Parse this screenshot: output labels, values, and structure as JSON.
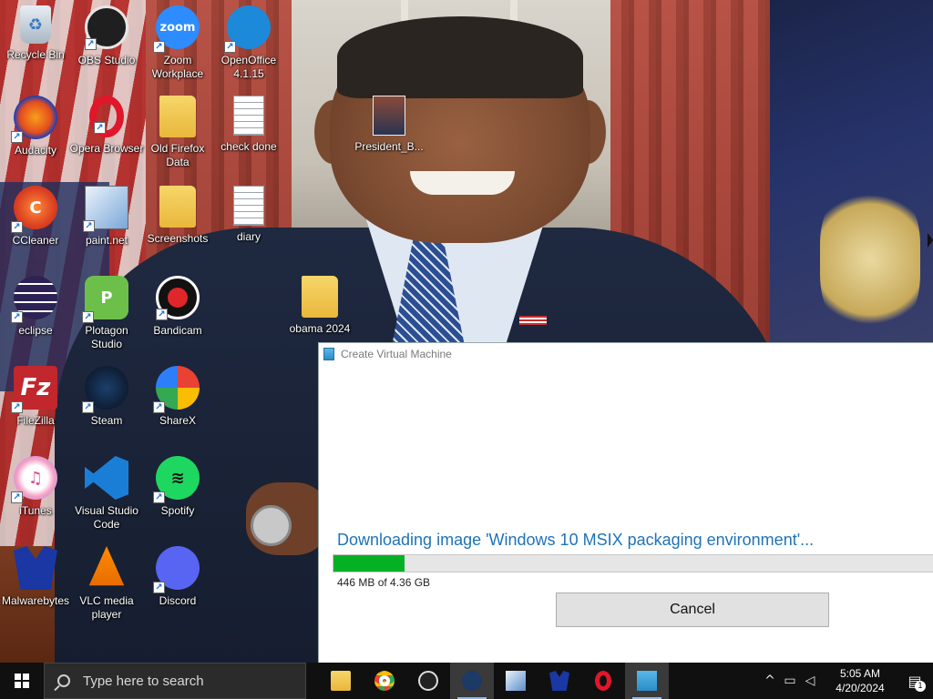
{
  "desktop": {
    "icons": [
      {
        "name": "recycle-bin",
        "label": "Recycle Bin",
        "glyph": "♻",
        "shortcut": false
      },
      {
        "name": "obs-studio",
        "label": "OBS Studio",
        "glyph": "",
        "shortcut": true
      },
      {
        "name": "zoom-workplace",
        "label": "Zoom Workplace",
        "glyph": "zoom",
        "shortcut": true
      },
      {
        "name": "openoffice",
        "label": "OpenOffice 4.1.15",
        "glyph": "",
        "shortcut": true
      },
      {
        "name": "audacity",
        "label": "Audacity",
        "glyph": "",
        "shortcut": true
      },
      {
        "name": "opera-browser",
        "label": "Opera Browser",
        "glyph": "",
        "shortcut": true
      },
      {
        "name": "old-firefox-data",
        "label": "Old Firefox Data",
        "glyph": "",
        "shortcut": false
      },
      {
        "name": "check-done",
        "label": "check done",
        "glyph": "",
        "shortcut": false
      },
      {
        "name": "president",
        "label": "President_B...",
        "glyph": "",
        "shortcut": false
      },
      {
        "name": "ccleaner",
        "label": "CCleaner",
        "glyph": "C",
        "shortcut": true
      },
      {
        "name": "paint-net",
        "label": "paint.net",
        "glyph": "",
        "shortcut": true
      },
      {
        "name": "screenshots",
        "label": "Screenshots",
        "glyph": "",
        "shortcut": false
      },
      {
        "name": "diary",
        "label": "diary",
        "glyph": "",
        "shortcut": false
      },
      {
        "name": "eclipse",
        "label": "eclipse",
        "glyph": "",
        "shortcut": true
      },
      {
        "name": "plotagon-studio",
        "label": "Plotagon Studio",
        "glyph": "P",
        "shortcut": true
      },
      {
        "name": "bandicam",
        "label": "Bandicam",
        "glyph": "",
        "shortcut": true
      },
      {
        "name": "obama-2024",
        "label": "obama 2024",
        "glyph": "",
        "shortcut": false
      },
      {
        "name": "filezilla",
        "label": "FileZilla",
        "glyph": "Fz",
        "shortcut": true
      },
      {
        "name": "steam",
        "label": "Steam",
        "glyph": "",
        "shortcut": true
      },
      {
        "name": "sharex",
        "label": "ShareX",
        "glyph": "",
        "shortcut": true
      },
      {
        "name": "itunes",
        "label": "iTunes",
        "glyph": "♫",
        "shortcut": true
      },
      {
        "name": "visual-studio-code",
        "label": "Visual Studio Code",
        "glyph": "",
        "shortcut": true
      },
      {
        "name": "spotify",
        "label": "Spotify",
        "glyph": "≋",
        "shortcut": true
      },
      {
        "name": "malwarebytes",
        "label": "Malwarebytes",
        "glyph": "",
        "shortcut": true
      },
      {
        "name": "vlc-media-player",
        "label": "VLC media player",
        "glyph": "",
        "shortcut": true
      },
      {
        "name": "discord",
        "label": "Discord",
        "glyph": "",
        "shortcut": true
      }
    ]
  },
  "dialog": {
    "title": "Create Virtual Machine",
    "status": "Downloading image 'Windows 10 MSIX packaging environment'...",
    "progress_fraction": 0.118,
    "progress_detail": "446 MB of 4.36 GB",
    "cancel_label": "Cancel"
  },
  "taskbar": {
    "search_placeholder": "Type here to search",
    "apps": [
      {
        "name": "file-explorer",
        "active": false,
        "running": false
      },
      {
        "name": "chrome",
        "active": false,
        "running": false
      },
      {
        "name": "obs-studio",
        "active": false,
        "running": false
      },
      {
        "name": "steam",
        "active": true,
        "running": true
      },
      {
        "name": "paint-net",
        "active": false,
        "running": false
      },
      {
        "name": "malwarebytes",
        "active": false,
        "running": false
      },
      {
        "name": "opera",
        "active": false,
        "running": false
      },
      {
        "name": "virtualbox",
        "active": true,
        "running": true
      }
    ],
    "time": "5:05 AM",
    "date": "4/20/2024",
    "notification_count": "1"
  }
}
